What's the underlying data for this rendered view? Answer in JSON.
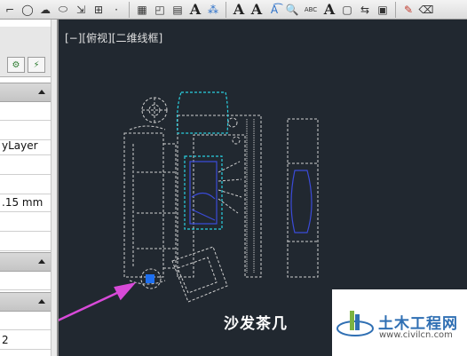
{
  "toolbar": {
    "text_buttons": [
      "A",
      "A",
      "A",
      "A"
    ],
    "spell_label": "ABC"
  },
  "viewport": {
    "label": "[−][俯视][二维线框]"
  },
  "properties": {
    "rows": [
      "yLayer",
      ".15 mm",
      "2"
    ]
  },
  "drawing": {
    "caption": "沙发茶几",
    "line_color": "#cfcfcf",
    "selected_color": "#2ad0e0",
    "highlight_color": "#3b4bd8",
    "grip_color": "#1e6ff0",
    "arrow_color": "#d84ad8"
  },
  "watermark": {
    "name": "土木工程网",
    "url": "www.civilcn.com"
  }
}
